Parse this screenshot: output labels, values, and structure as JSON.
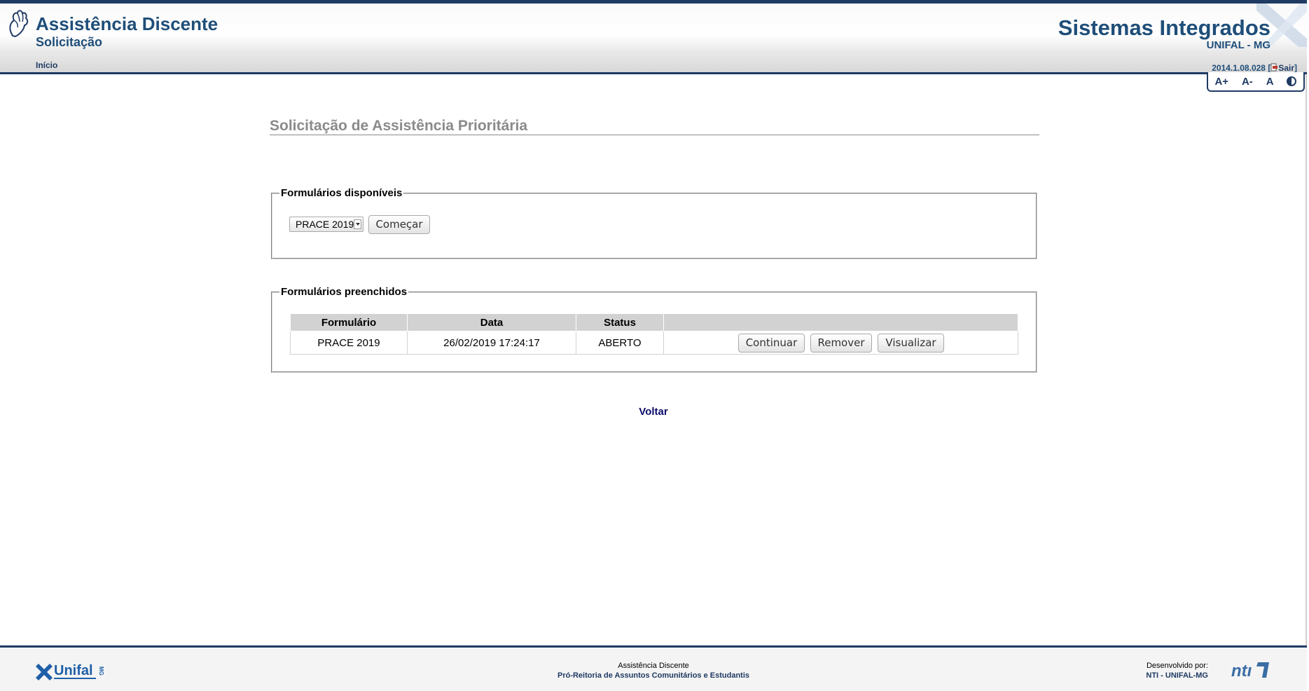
{
  "header": {
    "app_title": "Assistência Discente",
    "app_subtitle": "Solicitação",
    "menu_home": "Início",
    "system_title": "Sistemas Integrados",
    "system_subtitle": "UNIFAL - MG",
    "version": "2014.1.08.028",
    "version_open": "[",
    "logout": "Sair",
    "version_close": "]",
    "accessibility": {
      "increase_font": "A+",
      "decrease_font": "A-",
      "reset_font": "A",
      "contrast_icon": "contrast-icon"
    }
  },
  "main": {
    "page_title": "Solicitação de Assistência Prioritária",
    "available": {
      "legend": "Formulários disponíveis",
      "select_value": "PRACE 2019",
      "start_button": "Começar"
    },
    "filled": {
      "legend": "Formulários preenchidos",
      "columns": [
        "Formulário",
        "Data",
        "Status",
        ""
      ],
      "rows": [
        {
          "form": "PRACE 2019",
          "date": "26/02/2019 17:24:17",
          "status": "ABERTO",
          "continue": "Continuar",
          "remove": "Remover",
          "view": "Visualizar"
        }
      ]
    },
    "back_link": "Voltar"
  },
  "footer": {
    "center_line1": "Assistência Discente",
    "center_line2": "Pró-Reitoria de Assuntos Comunitários e Estudantis",
    "dev_label": "Desenvolvido por:",
    "dev_name": "NTI - UNIFAL-MG",
    "logo_left": "Unifal MG",
    "logo_right": "NTI"
  },
  "colors": {
    "brand": "#1f4e79",
    "header_border": "#1f3a63",
    "title_gray": "#8a8a8a"
  }
}
